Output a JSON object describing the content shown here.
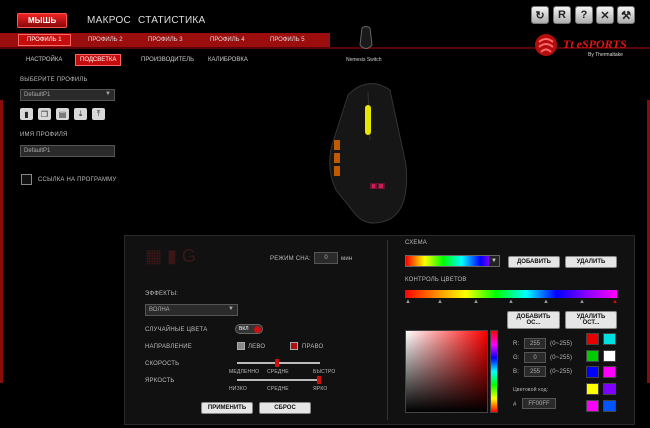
{
  "header": {
    "menu": [
      {
        "label": "МЫШЬ",
        "active": true
      },
      {
        "label": "МАКРОС",
        "active": false
      },
      {
        "label": "СТАТИСТИКА",
        "active": false
      }
    ],
    "icons": [
      "refresh-icon",
      "reset-icon",
      "help-icon",
      "close-icon",
      "settings-icon"
    ],
    "icon_glyphs": [
      "↻",
      "R",
      "?",
      "✕",
      "⚒"
    ]
  },
  "profiles": [
    {
      "label": "ПРОФИЛЬ 1",
      "active": true
    },
    {
      "label": "ПРОФИЛЬ 2",
      "active": false
    },
    {
      "label": "ПРОФИЛЬ 3",
      "active": false
    },
    {
      "label": "ПРОФИЛЬ 4",
      "active": false
    },
    {
      "label": "ПРОФИЛЬ 5",
      "active": false
    }
  ],
  "subtabs": [
    {
      "label": "НАСТРОЙКА",
      "active": false
    },
    {
      "label": "ПОДСВЕТКА",
      "active": true
    },
    {
      "label": "ПРОИЗВОДИТЕЛЬ",
      "active": false
    },
    {
      "label": "КАЛИБРОВКА",
      "active": false
    }
  ],
  "device": {
    "name": "Nemesis Switch"
  },
  "brand": {
    "logo": "Tt eSPORTS",
    "sub": "By Thermaltake"
  },
  "left": {
    "select_profile_label": "ВЫБЕРИТЕ ПРОФИЛЬ",
    "select_profile_value": "DefaultP1",
    "profile_name_label": "ИМЯ ПРОФИЛЯ",
    "profile_name_value": "DefaultP1",
    "link_label": "ССЫЛКА НА ПРОГРАММУ"
  },
  "lighting": {
    "sleep_label": "РЕЖИМ СНА:",
    "sleep_value": "0",
    "sleep_unit": "мин",
    "effects_label": "ЭФФЕКТЫ:",
    "effect_value": "ВОЛНА",
    "random_label": "СЛУЧАЙНЫЕ ЦВЕТА",
    "random_toggle": "ВКЛ",
    "direction_label": "НАПРАВЛЕНИЕ",
    "dir_left": "ЛЕВО",
    "dir_right": "ПРАВО",
    "speed_label": "СКОРОСТЬ",
    "speed_ticks": [
      "МЕДЛЕННО",
      "СРЕДНЕ",
      "БЫСТРО"
    ],
    "brightness_label": "ЯРКОСТЬ",
    "brightness_ticks": [
      "НИЗКО",
      "СРЕДНЕ",
      "ЯРКО"
    ],
    "apply": "ПРИМЕНИТЬ",
    "reset": "СБРОС",
    "scheme_label": "СХЕМА",
    "add": "ДОБАВИТЬ",
    "delete": "УДАЛИТЬ",
    "color_control_label": "КОНТРОЛЬ ЦВЕТОВ",
    "add_point": "ДОБАВИТЬ ОС...",
    "delete_point": "УДАЛИТЬ ОСТ...",
    "r_label": "R:",
    "r_value": "255",
    "r_range": "(0~255)",
    "g_label": "G:",
    "g_value": "0",
    "g_range": "(0~255)",
    "b_label": "B:",
    "b_value": "255",
    "b_range": "(0~255)",
    "color_code_label": "Цветовой код:",
    "hash": "#",
    "color_code": "FF00FF"
  },
  "palette": [
    "#e60000",
    "#00e0e0",
    "#00cc00",
    "#ffffff",
    "#0000ff",
    "#ff00ff",
    "#ffff00",
    "#8000ff",
    "#ff00ff",
    "#0055ff"
  ]
}
